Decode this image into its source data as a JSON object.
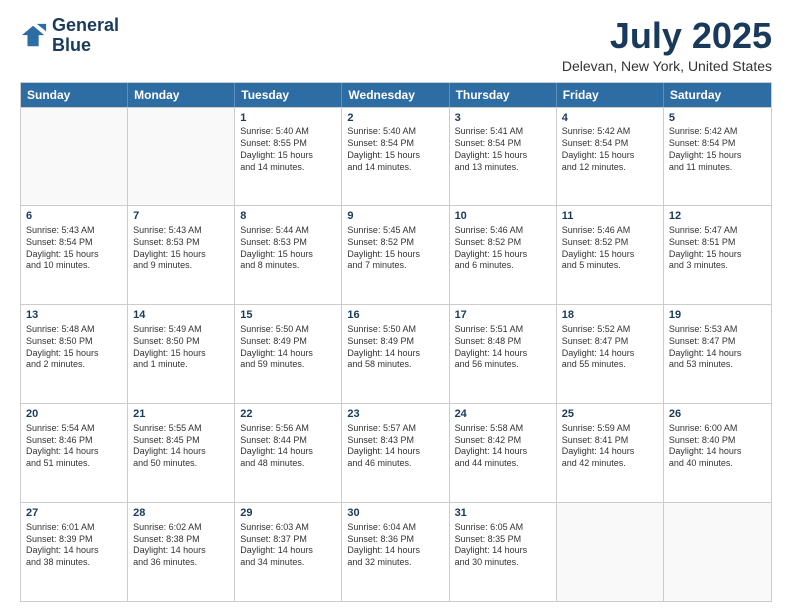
{
  "logo": {
    "line1": "General",
    "line2": "Blue"
  },
  "title": "July 2025",
  "subtitle": "Delevan, New York, United States",
  "header_days": [
    "Sunday",
    "Monday",
    "Tuesday",
    "Wednesday",
    "Thursday",
    "Friday",
    "Saturday"
  ],
  "weeks": [
    [
      {
        "day": "",
        "lines": []
      },
      {
        "day": "",
        "lines": []
      },
      {
        "day": "1",
        "lines": [
          "Sunrise: 5:40 AM",
          "Sunset: 8:55 PM",
          "Daylight: 15 hours",
          "and 14 minutes."
        ]
      },
      {
        "day": "2",
        "lines": [
          "Sunrise: 5:40 AM",
          "Sunset: 8:54 PM",
          "Daylight: 15 hours",
          "and 14 minutes."
        ]
      },
      {
        "day": "3",
        "lines": [
          "Sunrise: 5:41 AM",
          "Sunset: 8:54 PM",
          "Daylight: 15 hours",
          "and 13 minutes."
        ]
      },
      {
        "day": "4",
        "lines": [
          "Sunrise: 5:42 AM",
          "Sunset: 8:54 PM",
          "Daylight: 15 hours",
          "and 12 minutes."
        ]
      },
      {
        "day": "5",
        "lines": [
          "Sunrise: 5:42 AM",
          "Sunset: 8:54 PM",
          "Daylight: 15 hours",
          "and 11 minutes."
        ]
      }
    ],
    [
      {
        "day": "6",
        "lines": [
          "Sunrise: 5:43 AM",
          "Sunset: 8:54 PM",
          "Daylight: 15 hours",
          "and 10 minutes."
        ]
      },
      {
        "day": "7",
        "lines": [
          "Sunrise: 5:43 AM",
          "Sunset: 8:53 PM",
          "Daylight: 15 hours",
          "and 9 minutes."
        ]
      },
      {
        "day": "8",
        "lines": [
          "Sunrise: 5:44 AM",
          "Sunset: 8:53 PM",
          "Daylight: 15 hours",
          "and 8 minutes."
        ]
      },
      {
        "day": "9",
        "lines": [
          "Sunrise: 5:45 AM",
          "Sunset: 8:52 PM",
          "Daylight: 15 hours",
          "and 7 minutes."
        ]
      },
      {
        "day": "10",
        "lines": [
          "Sunrise: 5:46 AM",
          "Sunset: 8:52 PM",
          "Daylight: 15 hours",
          "and 6 minutes."
        ]
      },
      {
        "day": "11",
        "lines": [
          "Sunrise: 5:46 AM",
          "Sunset: 8:52 PM",
          "Daylight: 15 hours",
          "and 5 minutes."
        ]
      },
      {
        "day": "12",
        "lines": [
          "Sunrise: 5:47 AM",
          "Sunset: 8:51 PM",
          "Daylight: 15 hours",
          "and 3 minutes."
        ]
      }
    ],
    [
      {
        "day": "13",
        "lines": [
          "Sunrise: 5:48 AM",
          "Sunset: 8:50 PM",
          "Daylight: 15 hours",
          "and 2 minutes."
        ]
      },
      {
        "day": "14",
        "lines": [
          "Sunrise: 5:49 AM",
          "Sunset: 8:50 PM",
          "Daylight: 15 hours",
          "and 1 minute."
        ]
      },
      {
        "day": "15",
        "lines": [
          "Sunrise: 5:50 AM",
          "Sunset: 8:49 PM",
          "Daylight: 14 hours",
          "and 59 minutes."
        ]
      },
      {
        "day": "16",
        "lines": [
          "Sunrise: 5:50 AM",
          "Sunset: 8:49 PM",
          "Daylight: 14 hours",
          "and 58 minutes."
        ]
      },
      {
        "day": "17",
        "lines": [
          "Sunrise: 5:51 AM",
          "Sunset: 8:48 PM",
          "Daylight: 14 hours",
          "and 56 minutes."
        ]
      },
      {
        "day": "18",
        "lines": [
          "Sunrise: 5:52 AM",
          "Sunset: 8:47 PM",
          "Daylight: 14 hours",
          "and 55 minutes."
        ]
      },
      {
        "day": "19",
        "lines": [
          "Sunrise: 5:53 AM",
          "Sunset: 8:47 PM",
          "Daylight: 14 hours",
          "and 53 minutes."
        ]
      }
    ],
    [
      {
        "day": "20",
        "lines": [
          "Sunrise: 5:54 AM",
          "Sunset: 8:46 PM",
          "Daylight: 14 hours",
          "and 51 minutes."
        ]
      },
      {
        "day": "21",
        "lines": [
          "Sunrise: 5:55 AM",
          "Sunset: 8:45 PM",
          "Daylight: 14 hours",
          "and 50 minutes."
        ]
      },
      {
        "day": "22",
        "lines": [
          "Sunrise: 5:56 AM",
          "Sunset: 8:44 PM",
          "Daylight: 14 hours",
          "and 48 minutes."
        ]
      },
      {
        "day": "23",
        "lines": [
          "Sunrise: 5:57 AM",
          "Sunset: 8:43 PM",
          "Daylight: 14 hours",
          "and 46 minutes."
        ]
      },
      {
        "day": "24",
        "lines": [
          "Sunrise: 5:58 AM",
          "Sunset: 8:42 PM",
          "Daylight: 14 hours",
          "and 44 minutes."
        ]
      },
      {
        "day": "25",
        "lines": [
          "Sunrise: 5:59 AM",
          "Sunset: 8:41 PM",
          "Daylight: 14 hours",
          "and 42 minutes."
        ]
      },
      {
        "day": "26",
        "lines": [
          "Sunrise: 6:00 AM",
          "Sunset: 8:40 PM",
          "Daylight: 14 hours",
          "and 40 minutes."
        ]
      }
    ],
    [
      {
        "day": "27",
        "lines": [
          "Sunrise: 6:01 AM",
          "Sunset: 8:39 PM",
          "Daylight: 14 hours",
          "and 38 minutes."
        ]
      },
      {
        "day": "28",
        "lines": [
          "Sunrise: 6:02 AM",
          "Sunset: 8:38 PM",
          "Daylight: 14 hours",
          "and 36 minutes."
        ]
      },
      {
        "day": "29",
        "lines": [
          "Sunrise: 6:03 AM",
          "Sunset: 8:37 PM",
          "Daylight: 14 hours",
          "and 34 minutes."
        ]
      },
      {
        "day": "30",
        "lines": [
          "Sunrise: 6:04 AM",
          "Sunset: 8:36 PM",
          "Daylight: 14 hours",
          "and 32 minutes."
        ]
      },
      {
        "day": "31",
        "lines": [
          "Sunrise: 6:05 AM",
          "Sunset: 8:35 PM",
          "Daylight: 14 hours",
          "and 30 minutes."
        ]
      },
      {
        "day": "",
        "lines": []
      },
      {
        "day": "",
        "lines": []
      }
    ]
  ]
}
